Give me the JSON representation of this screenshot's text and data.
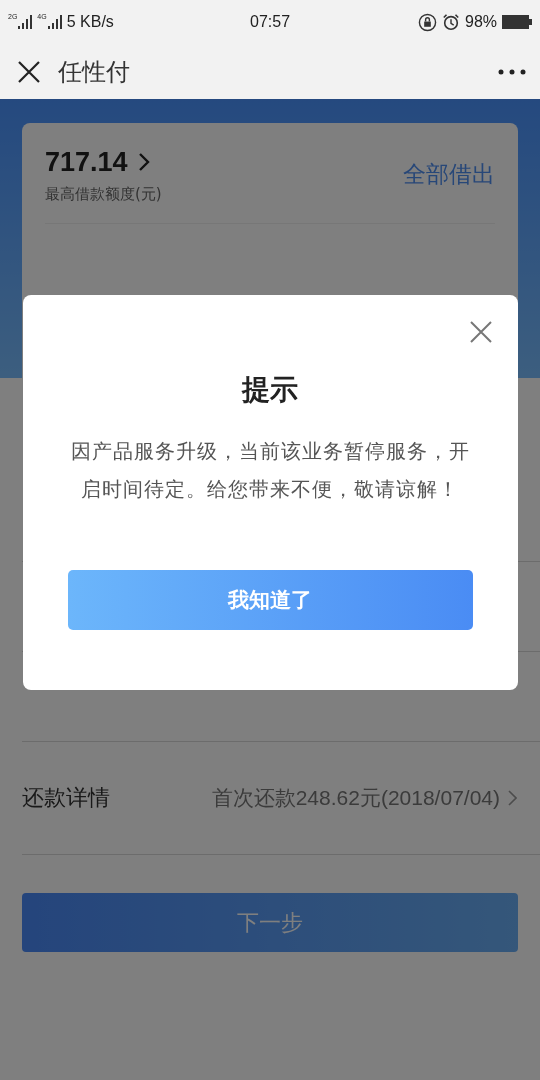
{
  "status_bar": {
    "network_labels": [
      "2G",
      "4G"
    ],
    "speed": "5 KB/s",
    "time": "07:57",
    "battery": "98%"
  },
  "nav": {
    "title": "任性付"
  },
  "card": {
    "limit_amount": "717.14",
    "limit_label": "最高借款额度(元)",
    "borrow_all": "全部借出"
  },
  "rows": [
    {
      "label": "还款详情",
      "value": "首次还款248.62元(2018/07/04)",
      "kind": "link"
    }
  ],
  "next_button": {
    "label": "下一步"
  },
  "dialog": {
    "title": "提示",
    "message": "因产品服务升级，当前该业务暂停服务，开启时间待定。给您带来不便，敬请谅解！",
    "button": "我知道了"
  }
}
